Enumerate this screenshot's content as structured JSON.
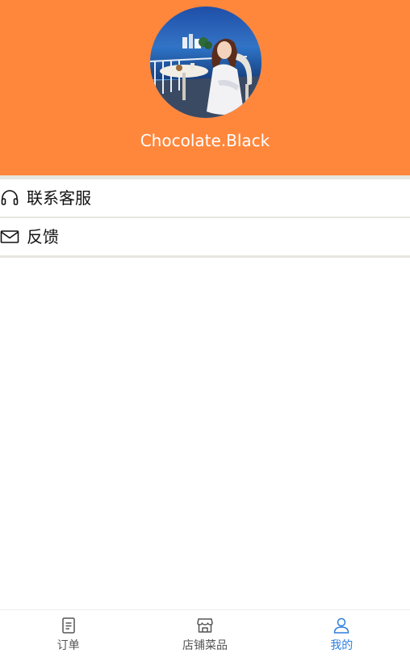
{
  "profile": {
    "username": "Chocolate.Black"
  },
  "menu": {
    "items": [
      {
        "label": "联系客服",
        "icon": "headset-icon"
      },
      {
        "label": "反馈",
        "icon": "envelope-icon"
      }
    ]
  },
  "tabbar": {
    "active_index": 2,
    "active_color": "#2D7FE0",
    "items": [
      {
        "label": "订单",
        "icon": "document-icon"
      },
      {
        "label": "店铺菜品",
        "icon": "storefront-icon"
      },
      {
        "label": "我的",
        "icon": "user-icon"
      }
    ]
  },
  "colors": {
    "header_bg": "#FF873C",
    "separator": "#E7E6DF",
    "text": "#111111"
  }
}
